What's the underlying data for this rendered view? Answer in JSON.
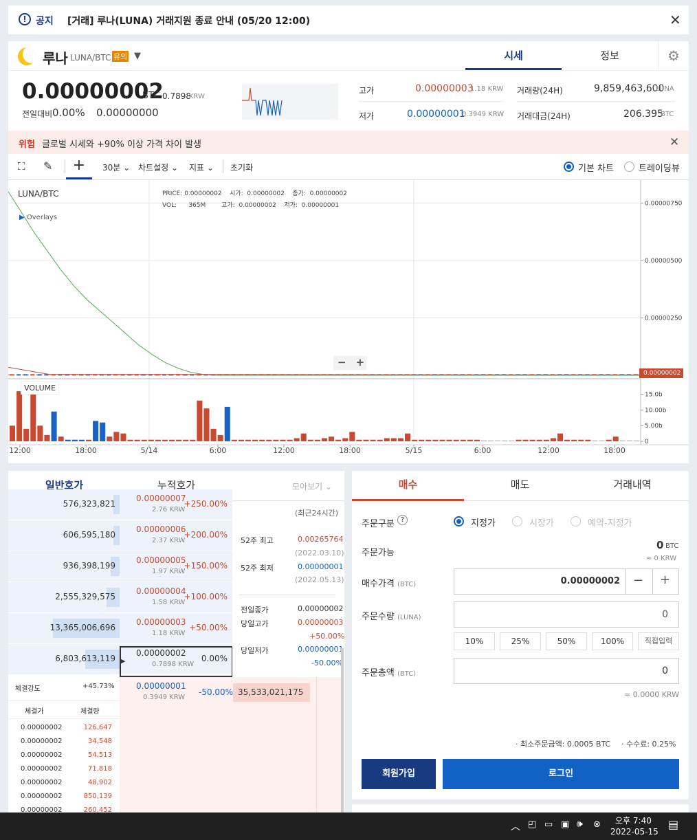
{
  "notice": {
    "icon": "info-circle-icon",
    "label": "공지",
    "text": "[거래] 루나(LUNA) 거래지원 종료 안내 (05/20 12:00)"
  },
  "coin": {
    "name": "루나",
    "pair": "LUNA/BTC",
    "badge": "유의",
    "tabs": [
      "시세",
      "정보"
    ],
    "price": "0.00000002",
    "unit": "BTC",
    "krw": "0.7898",
    "krw_unit": "KRW",
    "change_label": "전일대비",
    "change_pct": "0.00%",
    "change_val": "0.00000000"
  },
  "stats": {
    "high_label": "고가",
    "high": "0.00000003",
    "high_krw": "1.18 KRW",
    "low_label": "저가",
    "low": "0.00000001",
    "low_krw": "0.3949 KRW",
    "vol_label": "거래량(24H)",
    "vol": "9,859,463,600",
    "vol_unit": "LUNA",
    "amt_label": "거래대금(24H)",
    "amt": "206.395",
    "amt_unit": "BTC"
  },
  "warning": {
    "label": "위험",
    "text": "글로벌 시세와 +90% 이상 가격 차이 발생"
  },
  "toolbar": {
    "interval": "30분",
    "settings": "차트설정",
    "indicators": "지표",
    "reset": "초기화",
    "basic_chart": "기본 차트",
    "tradingview": "트레이딩뷰"
  },
  "chart": {
    "pair": "LUNA/BTC",
    "overlays": "Overlays",
    "info": {
      "price_l": "PRICE:",
      "price": "0.00000002",
      "open_l": "시가:",
      "open": "0.00000002",
      "close_l": "종가:",
      "close": "0.00000002",
      "vol_l": "VOL:",
      "vol": "365M",
      "high_l": "고가:",
      "high": "0.00000002",
      "low_l": "저가:",
      "low": "0.00000001"
    },
    "volume_label": "VOLUME",
    "last_price": "0.00000002"
  },
  "chart_data": {
    "type": "line",
    "y_ticks": [
      "0.00000750",
      "0.00000500",
      "0.00000250"
    ],
    "vol_ticks": [
      "15.0b",
      "10.00b",
      "5.00b",
      "0"
    ],
    "x_ticks": [
      "12:00",
      "18:00",
      "5/14",
      "6:00",
      "12:00",
      "18:00",
      "5/15",
      "6:00",
      "12:00",
      "18:00"
    ],
    "ylim": [
      0,
      8.5e-06
    ],
    "vol_ylim": [
      0,
      18
    ],
    "ma_line": [
      8.0,
      7.1,
      6.2,
      5.4,
      4.6,
      3.9,
      3.3,
      2.8,
      2.3,
      1.8,
      1.3,
      0.9,
      0.55,
      0.3,
      0.12,
      0.03,
      0.0
    ],
    "volumes": [
      {
        "v": 5,
        "c": "red"
      },
      {
        "v": 16,
        "c": "red"
      },
      {
        "v": 4,
        "c": "red"
      },
      {
        "v": 17,
        "c": "red"
      },
      {
        "v": 5,
        "c": "red"
      },
      {
        "v": 2,
        "c": "red"
      },
      {
        "v": 9.5,
        "c": "blue"
      },
      {
        "v": 1.5,
        "c": "red"
      },
      {
        "v": 0.5,
        "c": "blue"
      },
      {
        "v": 0.5,
        "c": "blue"
      },
      {
        "v": 0.5,
        "c": "blue"
      },
      {
        "v": 0.5,
        "c": "red"
      },
      {
        "v": 6.5,
        "c": "blue"
      },
      {
        "v": 6,
        "c": "blue"
      },
      {
        "v": 1.5,
        "c": "red"
      },
      {
        "v": 3,
        "c": "red"
      },
      {
        "v": 2.5,
        "c": "red"
      },
      {
        "v": 0.5,
        "c": "red"
      },
      {
        "v": 0.5,
        "c": "red"
      },
      {
        "v": 0.5,
        "c": "red"
      },
      {
        "v": 0.5,
        "c": "red"
      },
      {
        "v": 0.5,
        "c": "red"
      },
      {
        "v": 0.5,
        "c": "red"
      },
      {
        "v": 0.5,
        "c": "red"
      },
      {
        "v": 0.5,
        "c": "red"
      },
      {
        "v": 0.5,
        "c": "red"
      },
      {
        "v": 0.5,
        "c": "red"
      },
      {
        "v": 13,
        "c": "red"
      },
      {
        "v": 10.5,
        "c": "red"
      },
      {
        "v": 4,
        "c": "red"
      },
      {
        "v": 2,
        "c": "red"
      },
      {
        "v": 11,
        "c": "blue"
      },
      {
        "v": 0.5,
        "c": "red"
      },
      {
        "v": 0.5,
        "c": "red"
      },
      {
        "v": 0.5,
        "c": "red"
      },
      {
        "v": 0.5,
        "c": "red"
      },
      {
        "v": 0.5,
        "c": "red"
      },
      {
        "v": 0.5,
        "c": "red"
      },
      {
        "v": 0.5,
        "c": "red"
      },
      {
        "v": 0.5,
        "c": "red"
      },
      {
        "v": 0.5,
        "c": "red"
      },
      {
        "v": 1,
        "c": "red"
      },
      {
        "v": 2.5,
        "c": "red"
      },
      {
        "v": 0.5,
        "c": "red"
      },
      {
        "v": 0.5,
        "c": "red"
      },
      {
        "v": 1,
        "c": "red"
      },
      {
        "v": 1.5,
        "c": "red"
      },
      {
        "v": 0.5,
        "c": "red"
      },
      {
        "v": 1,
        "c": "red"
      },
      {
        "v": 3,
        "c": "red"
      },
      {
        "v": 0.5,
        "c": "red"
      },
      {
        "v": 0.5,
        "c": "red"
      },
      {
        "v": 0.5,
        "c": "red"
      },
      {
        "v": 0.5,
        "c": "red"
      },
      {
        "v": 1,
        "c": "red"
      },
      {
        "v": 1,
        "c": "red"
      },
      {
        "v": 1,
        "c": "red"
      },
      {
        "v": 2.5,
        "c": "red"
      },
      {
        "v": 0.5,
        "c": "red"
      },
      {
        "v": 0.5,
        "c": "red"
      },
      {
        "v": 0.5,
        "c": "red"
      },
      {
        "v": 0.5,
        "c": "red"
      },
      {
        "v": 0.5,
        "c": "red"
      },
      {
        "v": 0.5,
        "c": "red"
      },
      {
        "v": 0.5,
        "c": "red"
      },
      {
        "v": 0.5,
        "c": "red"
      },
      {
        "v": 0.5,
        "c": "red"
      },
      {
        "v": 0.5,
        "c": "red"
      },
      {
        "v": 0.3,
        "c": "gray"
      },
      {
        "v": 0.3,
        "c": "gray"
      },
      {
        "v": 0.3,
        "c": "gray"
      },
      {
        "v": 0.3,
        "c": "gray"
      },
      {
        "v": 0.3,
        "c": "gray"
      },
      {
        "v": 0.5,
        "c": "red"
      },
      {
        "v": 0.5,
        "c": "red"
      },
      {
        "v": 0.5,
        "c": "red"
      },
      {
        "v": 0.5,
        "c": "red"
      },
      {
        "v": 0.5,
        "c": "red"
      },
      {
        "v": 1,
        "c": "red"
      },
      {
        "v": 2.5,
        "c": "red"
      },
      {
        "v": 0.5,
        "c": "red"
      },
      {
        "v": 0.5,
        "c": "red"
      },
      {
        "v": 0.5,
        "c": "red"
      },
      {
        "v": 0.5,
        "c": "red"
      },
      {
        "v": 0.3,
        "c": "gray"
      },
      {
        "v": 0.3,
        "c": "gray"
      },
      {
        "v": 0.5,
        "c": "red"
      },
      {
        "v": 1.5,
        "c": "red"
      },
      {
        "v": 0.3,
        "c": "gray"
      },
      {
        "v": 0.3,
        "c": "gray"
      },
      {
        "v": 0.3,
        "c": "gray"
      }
    ]
  },
  "orderbook": {
    "tabs": [
      "일반호가",
      "누적호가"
    ],
    "view": "모아보기",
    "asks": [
      {
        "qty": "576,323,821",
        "price": "0.00000007",
        "krw": "2.76 KRW",
        "pct": "+250.00%",
        "bar": 4
      },
      {
        "qty": "606,595,180",
        "price": "0.00000006",
        "krw": "2.37 KRW",
        "pct": "+200.00%",
        "bar": 4
      },
      {
        "qty": "936,398,199",
        "price": "0.00000005",
        "krw": "1.97 KRW",
        "pct": "+150.00%",
        "bar": 6
      },
      {
        "qty": "2,555,329,575",
        "price": "0.00000004",
        "krw": "1.58 KRW",
        "pct": "+100.00%",
        "bar": 9
      },
      {
        "qty": "13,365,006,696",
        "price": "0.00000003",
        "krw": "1.18 KRW",
        "pct": "+50.00%",
        "bar": 45
      },
      {
        "qty": "6,803,613,119",
        "price": "0.00000002",
        "krw": "0.7898 KRW",
        "pct": "0.00%",
        "bar": 23
      }
    ],
    "bid": {
      "qty": "35,533,021,175",
      "price": "0.00000001",
      "krw": "0.3949 KRW",
      "pct": "-50.00%"
    },
    "info": {
      "recent": "(최근24시간)",
      "w52h_l": "52주 최고",
      "w52h": "0.00265764",
      "w52h_d": "(2022.03.10)",
      "w52l_l": "52주 최저",
      "w52l": "0.00000001",
      "w52l_d": "(2022.05.13)",
      "prev_l": "전일종가",
      "prev": "0.00000002",
      "dh_l": "당일고가",
      "dh": "0.00000003",
      "dh_p": "+50.00%",
      "dl_l": "당일저가",
      "dl": "0.00000001",
      "dl_p": "-50.00%"
    },
    "strength_l": "체결강도",
    "strength": "+45.73%",
    "th_price": "체결가",
    "th_qty": "체결량",
    "trades": [
      {
        "p": "0.00000002",
        "q": "126,647"
      },
      {
        "p": "0.00000002",
        "q": "34,548"
      },
      {
        "p": "0.00000002",
        "q": "54,513"
      },
      {
        "p": "0.00000002",
        "q": "71,818"
      },
      {
        "p": "0.00000002",
        "q": "48,902"
      },
      {
        "p": "0.00000002",
        "q": "850,139"
      },
      {
        "p": "0.00000002",
        "q": "260,452"
      }
    ]
  },
  "order": {
    "tabs": [
      "매수",
      "매도",
      "거래내역"
    ],
    "type_l": "주문구분",
    "types": [
      "지정가",
      "시장가",
      "예약-지정가"
    ],
    "avail_l": "주문가능",
    "avail": "0",
    "avail_unit": "BTC",
    "avail_krw": "≈ 0 KRW",
    "price_l": "매수가격",
    "price_u": "(BTC)",
    "price": "0.00000002",
    "qty_l": "주문수량",
    "qty_u": "(LUNA)",
    "qty": "0",
    "pcts": [
      "10%",
      "25%",
      "50%",
      "100%",
      "직접입력"
    ],
    "total_l": "주문총액",
    "total_u": "(BTC)",
    "total": "0",
    "total_krw": "≈ 0.0000 KRW",
    "min_order": "· 최소주문금액: 0.0005 BTC",
    "fee": "· 수수료: 0.25%",
    "signup": "회원가입",
    "login": "로그인"
  },
  "taskbar": {
    "time": "오후 7:40",
    "date": "2022-05-15"
  }
}
